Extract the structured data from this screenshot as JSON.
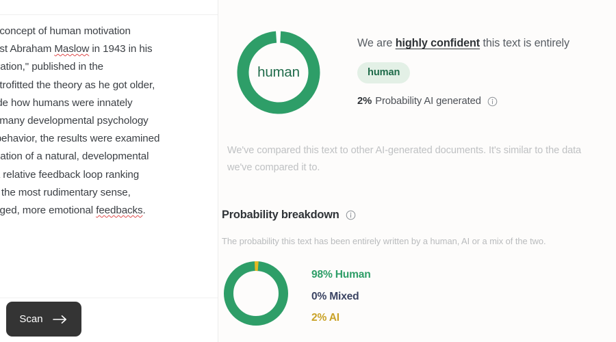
{
  "document_panel": {
    "name": "scanned-text-document",
    "text": "ds is a concept of human motivation\nchologist Abraham §Maslow§ in 1943 in his\nn Motivation,\" published in the\n§slow§ retrofitted the theory as he got older,\no include how humans were innately\ner, like many developmental psychology\numan behavior, the results were examined\n explanation of a natural, developmental\nory is a relative feedback loop ranking\nroup in the most rudimentary sense,\nnowledged, more emotional §feedbacks§.",
    "scan_button_label": "Scan",
    "scan_arrow_icon": "arrow-right-icon"
  },
  "result_panel": {
    "verdict": {
      "donut_center_label": "human",
      "donut_icon": "donut-chart-human-confidence",
      "headline_prefix": "We are ",
      "headline_emphasis": "highly confident",
      "headline_suffix": " this text is entirely",
      "badge_label": "human",
      "probability_percent": "2%",
      "probability_label": "Probability AI generated",
      "probability_info_icon": "info-icon"
    },
    "comparison_note": "We've compared this text to other AI-generated documents. It's similar to the data we've compared it to.",
    "breakdown": {
      "title": "Probability breakdown",
      "title_info_icon": "info-icon",
      "subtitle": "The probability this text has been entirely written by a human, AI or a mix of the two.",
      "legend": [
        {
          "label": "98% Human",
          "color": "#2e9e68"
        },
        {
          "label": "0% Mixed",
          "color": "#3b4463"
        },
        {
          "label": "2% AI",
          "color": "#c9a227"
        }
      ]
    }
  },
  "chart_data": [
    {
      "type": "pie",
      "name": "overall-confidence-donut",
      "title": "human",
      "categories": [
        "Human",
        "AI"
      ],
      "values": [
        98,
        2
      ],
      "colors": [
        "#2e9e68",
        "#ffffff"
      ],
      "units": "%",
      "legend": "none",
      "notes": "Ring is nearly fully green with a thin gap at the top representing 2% AI."
    },
    {
      "type": "pie",
      "name": "probability-breakdown-donut",
      "title": "Probability breakdown",
      "categories": [
        "Human",
        "Mixed",
        "AI"
      ],
      "values": [
        98,
        0,
        2
      ],
      "colors": [
        "#2e9e68",
        "#3b4463",
        "#e5b823"
      ],
      "units": "%",
      "legend": "right",
      "legend_entries": [
        "98% Human",
        "0% Mixed",
        "2% AI"
      ]
    }
  ],
  "theme": {
    "green": "#2e9e68",
    "dark_green": "#1f6b4a",
    "badge_bg": "#e3f0e6",
    "gold": "#e5b823",
    "navy": "#3b4463",
    "button_bg": "#343434",
    "panel_bg": "#fdfcfb"
  }
}
